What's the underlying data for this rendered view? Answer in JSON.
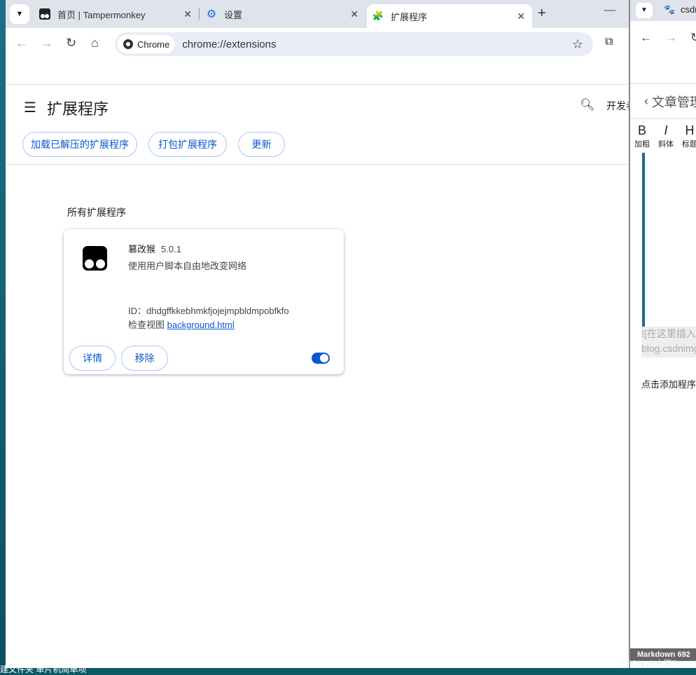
{
  "taskbar": {
    "text": "建文件夹  单片机简单项"
  },
  "tabs": [
    {
      "label": "首页 | Tampermonkey",
      "icon": "tampermonkey-icon"
    },
    {
      "label": "设置",
      "icon": "gear-icon"
    },
    {
      "label": "扩展程序",
      "icon": "puzzle-icon",
      "active": true
    }
  ],
  "omnibox": {
    "chip": "Chrome",
    "url": "chrome://extensions"
  },
  "header": {
    "title": "扩展程序",
    "dev_mode": "开发者模式"
  },
  "actions": {
    "load": "加载已解压的扩展程序",
    "pack": "打包扩展程序",
    "update": "更新"
  },
  "section": "所有扩展程序",
  "extension": {
    "name": "篡改猴",
    "version": "5.0.1",
    "description": "使用用户脚本自由地改变网络",
    "id": "ID：dhdgffkkebhmkfjojejmpbldmpobfkfo",
    "inspect_label": "检查视图",
    "inspect_link": "background.html",
    "details": "详情",
    "remove": "移除",
    "enabled": true
  },
  "right_window": {
    "tab": "csdn",
    "article": "文章管理",
    "fmt": [
      "加粗",
      "斜体",
      "标题"
    ],
    "insert": "![在这里插入图片描述](https://img-blog.csdnimg.cn",
    "insert2": "blog.csdnimg",
    "add": "点击添加程序",
    "status": "Markdown  692"
  },
  "watermark": "CSDN @水豚Zz",
  "accent": "#0b57d0"
}
